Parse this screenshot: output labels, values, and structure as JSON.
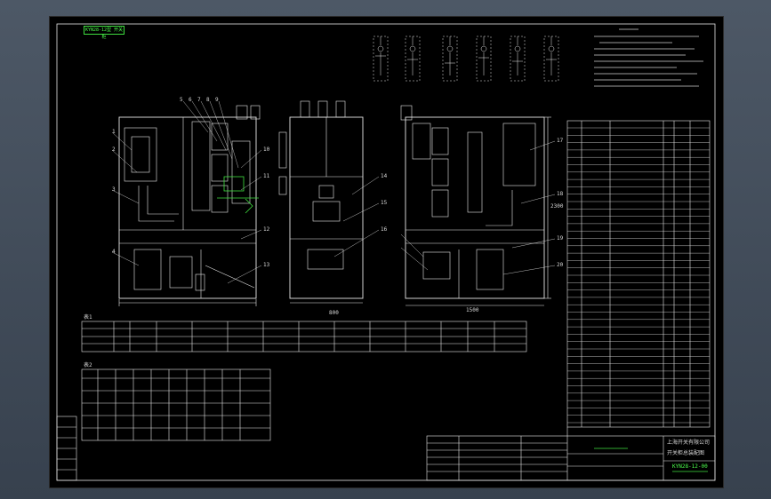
{
  "drawing": {
    "frame_tag": "KYN28-12型 开关柜",
    "view_dimensions": {
      "width_mm": "800",
      "depth_mm": "1500",
      "height_mm": "2300"
    },
    "part_callouts": [
      "1",
      "2",
      "3",
      "4",
      "5",
      "6",
      "7",
      "8",
      "9",
      "10",
      "11",
      "12",
      "13",
      "14",
      "15",
      "16",
      "17",
      "18",
      "19",
      "20"
    ],
    "table_titles": {
      "table1": "表1",
      "table2": "表2"
    },
    "title_block": {
      "company": "上海开关有限公司",
      "drawing_name": "开关柜总装配图",
      "drawing_no": "KYN28-12-00"
    }
  },
  "colors": {
    "background": "#000000",
    "lines": "#e8e8e8",
    "highlight": "#3fe03f",
    "desktop": "#3a4452"
  }
}
